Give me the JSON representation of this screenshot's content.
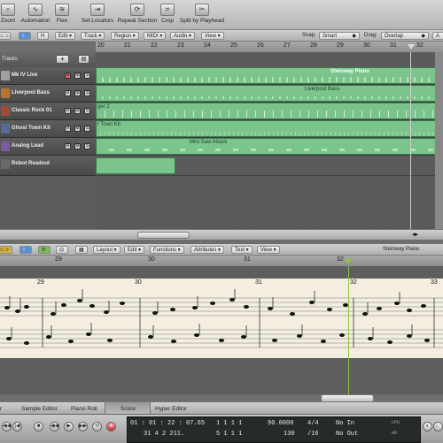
{
  "toolbar": {
    "buttons": [
      {
        "label": "Zoom",
        "icon": "zoom-icon"
      },
      {
        "label": "Automation",
        "icon": "automation-icon"
      },
      {
        "label": "Flex",
        "icon": "flex-icon"
      },
      {
        "label": "Set Locators",
        "icon": "set-locators-icon"
      },
      {
        "label": "Repeat Section",
        "icon": "repeat-section-icon"
      },
      {
        "label": "Crop",
        "icon": "crop-icon"
      },
      {
        "label": "Split by Playhead",
        "icon": "split-by-playhead-icon"
      }
    ]
  },
  "arrange_menu": {
    "items": [
      "Edit",
      "Track",
      "Region",
      "MIDI",
      "Audio",
      "View"
    ],
    "snap_label": "Snap:",
    "snap_value": "Smart",
    "drag_label": "Drag:",
    "drag_value": "Overlap",
    "h_button": "H",
    "a_button": "A"
  },
  "arrange_ruler": {
    "bars": [
      "20",
      "21",
      "22",
      "23",
      "24",
      "25",
      "26",
      "27",
      "28",
      "29",
      "30",
      "31",
      "32"
    ]
  },
  "tracks_header": {
    "label": "Tracks",
    "add_label": "+"
  },
  "tracks": [
    {
      "name": "Mk IV Live",
      "color": "#a0a0a0",
      "r": "R",
      "m": "M",
      "s": "S"
    },
    {
      "name": "Liverpool Bass",
      "color": "#b8742c",
      "r": "R",
      "m": "M",
      "s": "S"
    },
    {
      "name": "Classic Rock 01",
      "color": "#a04a3a",
      "r": "R",
      "m": "M",
      "s": "S"
    },
    {
      "name": "Ghost Town Kit",
      "color": "#586a9c",
      "r": "R",
      "m": "M",
      "s": "S"
    },
    {
      "name": "Analog Lead",
      "color": "#7a5aa0",
      "r": "R",
      "m": "M",
      "s": "S"
    },
    {
      "name": "Robot Readout",
      "color": "#6a6a6a",
      "r": "R",
      "m": "M",
      "s": "S"
    }
  ],
  "regions": [
    {
      "name": "Steinway Piano"
    },
    {
      "name": "Liverpool Bass"
    },
    {
      "name": "ger 2"
    },
    {
      "name": "t Town Kit"
    },
    {
      "name": "Gh"
    },
    {
      "name": "Mini Saw Attack"
    },
    {
      "name": ""
    }
  ],
  "score_menu": {
    "items": [
      "Layout",
      "Edit",
      "Functions",
      "Attributes",
      "Text",
      "View"
    ],
    "track_name": "Steinway Piano"
  },
  "score_ruler": {
    "bars": [
      "29",
      "30",
      "31",
      "32"
    ]
  },
  "score_bars": [
    "29",
    "30",
    "31",
    "32",
    "33"
  ],
  "editor_tabs": [
    "r",
    "Sample Editor",
    "Piano Roll",
    "Score",
    "Hyper Editor"
  ],
  "active_tab": "Score",
  "lcd": {
    "time_row1": "01 : 01 : 22 : 07.65",
    "time_row2": "31  4  2  211.",
    "pos_row1": "1   1   1   1",
    "pos_row2": "5   1   1   1",
    "tempo": "90.0000",
    "tempo_row2": "130",
    "sig": "4/4",
    "div": "/16",
    "in": "No In",
    "out": "No Out",
    "cpu_label": "CPU",
    "hd_label": "HD"
  },
  "colors": {
    "region_green": "#7bc48c",
    "playhead": "#8ec63f",
    "score_paper": "#f3eee0"
  }
}
